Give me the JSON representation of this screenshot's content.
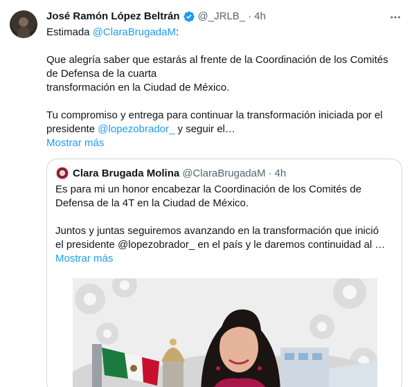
{
  "tweet": {
    "author_name": "José Ramón López Beltrán",
    "handle": "@_JRLB_",
    "separator": "·",
    "time": "4h",
    "text": {
      "line1_prefix": "Estimada ",
      "line1_mention": "@ClaraBrugadaM",
      "line1_suffix": ":",
      "para2_line1": "Que alegría saber que estarás al frente de la Coordinación de los Comités",
      "para2_line2": "de Defensa de la cuarta",
      "para2_line3": "transformación en la Ciudad de México.",
      "para3_line1": "Tu compromiso y entrega para continuar la transformación iniciada por el",
      "para3_line2_prefix": "presidente ",
      "para3_line2_mention": "@lopezobrador_",
      "para3_line2_suffix": " y seguir el…"
    },
    "show_more": "Mostrar más",
    "icons": {
      "verified": "verified-badge-icon",
      "more": "more-options-icon"
    },
    "colors": {
      "accent": "#1d9bf0",
      "text": "#0f1419",
      "muted": "#536471",
      "border": "#cfd9de"
    }
  },
  "quote": {
    "author_name": "Clara Brugada Molina",
    "handle": "@ClaraBrugadaM",
    "separator": "·",
    "time": "4h",
    "text": {
      "line1": "Es para mi un honor encabezar la Coordinación de los Comités de",
      "line2": "Defensa de la 4T en la Ciudad de México.",
      "line3": "Juntos y juntas seguiremos avanzando en la transformación que inició",
      "line4": "el presidente @lopezobrador_  en el país y le daremos continuidad al …"
    },
    "show_more": "Mostrar más"
  }
}
